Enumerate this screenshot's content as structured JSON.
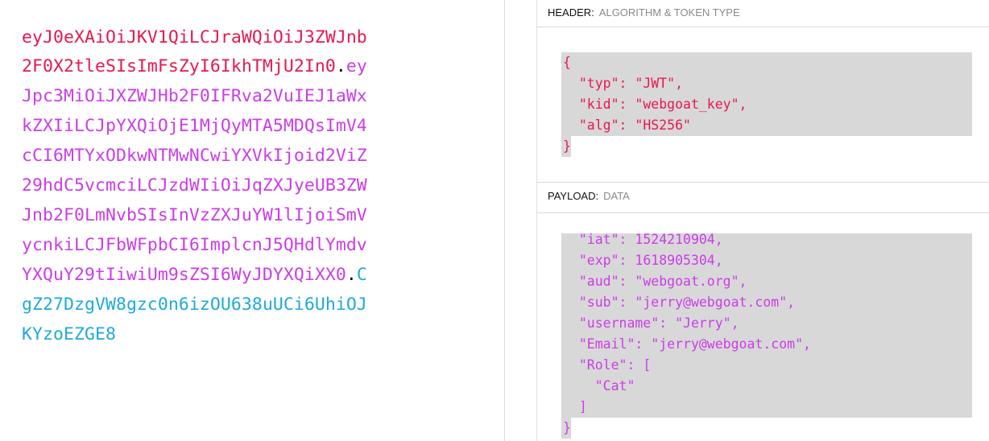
{
  "encoded_token": {
    "lines": [
      [
        {
          "text": "eyJ0eXAiOiJKV1QiLCJraWQiOiJ3ZWJnb",
          "part": "header"
        }
      ],
      [
        {
          "text": "2F0X2tleSIsImFsZyI6IkhTMjU2In0",
          "part": "header"
        },
        {
          "text": ".",
          "part": "dot"
        },
        {
          "text": "ey",
          "part": "payload"
        }
      ],
      [
        {
          "text": "Jpc3MiOiJXZWJHb2F0IFRva2VuIEJ1aWx",
          "part": "payload"
        }
      ],
      [
        {
          "text": "kZXIiLCJpYXQiOjE1MjQyMTA5MDQsImV4",
          "part": "payload"
        }
      ],
      [
        {
          "text": "cCI6MTYxODkwNTMwNCwiYXVkIjoid2ViZ",
          "part": "payload"
        }
      ],
      [
        {
          "text": "29hdC5vcmciLCJzdWIiOiJqZXJyeUB3ZW",
          "part": "payload"
        }
      ],
      [
        {
          "text": "Jnb2F0LmNvbSIsInVzZXJuYW1lIjoiSmV",
          "part": "payload"
        }
      ],
      [
        {
          "text": "ycnkiLCJFbWFpbCI6ImplcnJ5QHdlYmdv",
          "part": "payload"
        }
      ],
      [
        {
          "text": "YXQuY29tIiwiUm9sZSI6WyJDYXQiXX0",
          "part": "payload"
        },
        {
          "text": ".",
          "part": "dot"
        },
        {
          "text": "C",
          "part": "sig"
        }
      ],
      [
        {
          "text": "gZ27DzgVW8gzc0n6izOU638uUCi6UhiOJ",
          "part": "sig"
        }
      ],
      [
        {
          "text": "KYzoEZGE8",
          "part": "sig"
        }
      ]
    ]
  },
  "header_section": {
    "label": "HEADER:",
    "sublabel": "ALGORITHM & TOKEN TYPE",
    "json_lines": [
      "{",
      "  \"typ\": \"JWT\",",
      "  \"kid\": \"webgoat_key\",",
      "  \"alg\": \"HS256\"",
      "}"
    ]
  },
  "payload_section": {
    "label": "PAYLOAD:",
    "sublabel": "DATA",
    "json_lines": [
      "  \"iat\": 1524210904,",
      "  \"exp\": 1618905304,",
      "  \"aud\": \"webgoat.org\",",
      "  \"sub\": \"jerry@webgoat.com\",",
      "  \"username\": \"Jerry\",",
      "  \"Email\": \"jerry@webgoat.com\",",
      "  \"Role\": [",
      "    \"Cat\"",
      "  ]",
      "}"
    ]
  },
  "colors": {
    "header": "#e8184e",
    "payload": "#cc3ce8",
    "signature": "#1eaad9",
    "dot": "#000000",
    "json_background": "#d8d8d8"
  }
}
